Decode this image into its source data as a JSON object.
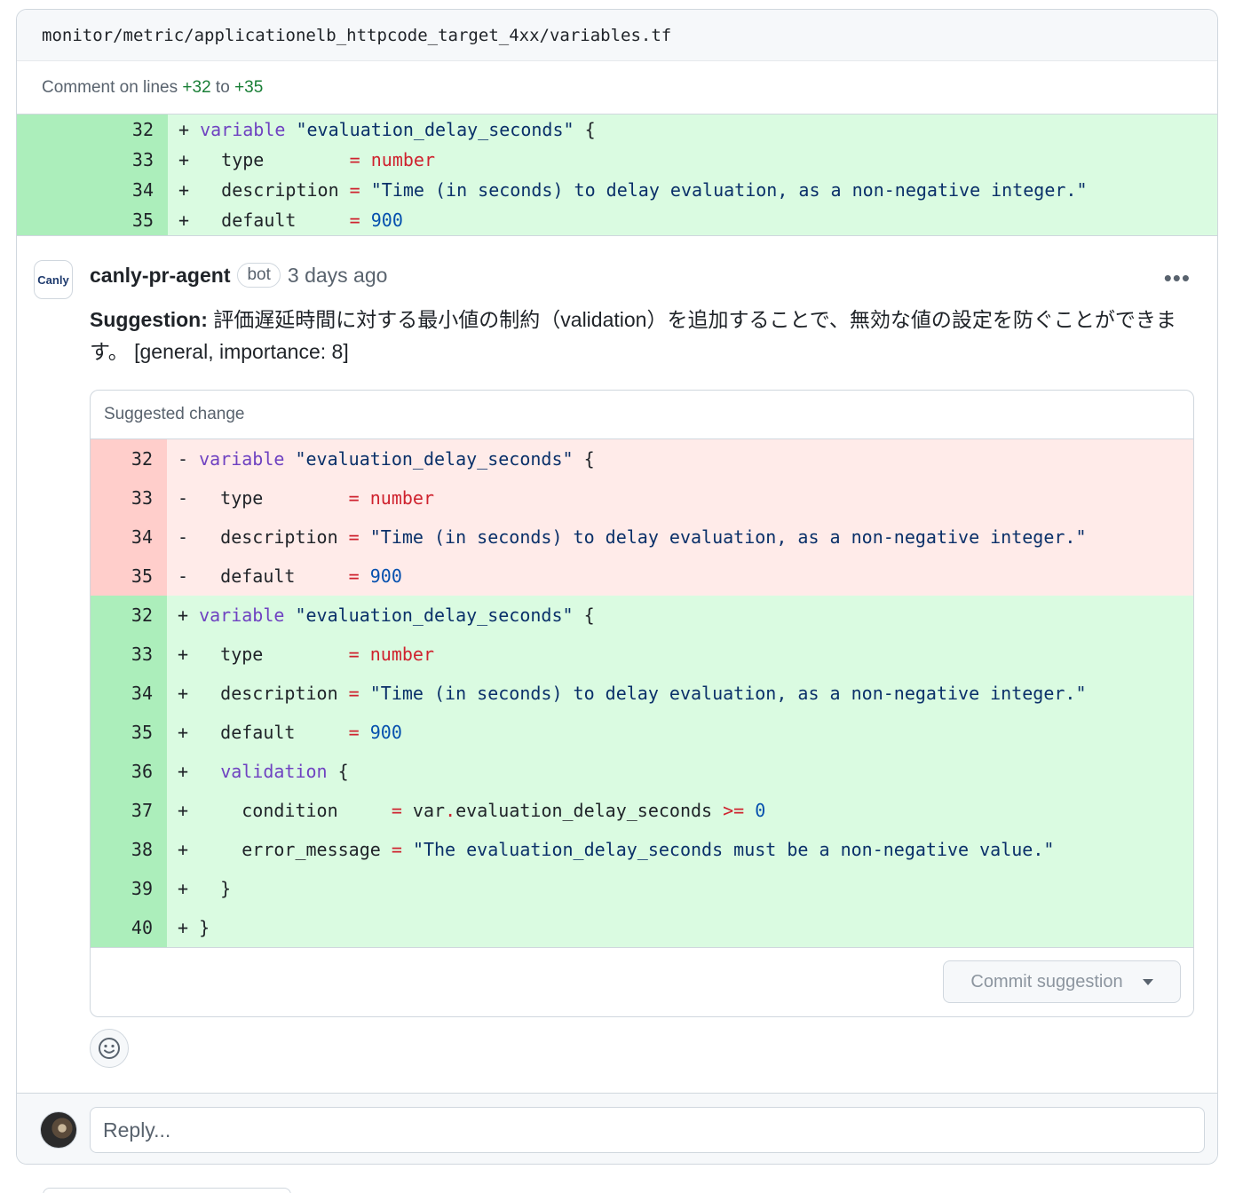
{
  "file": {
    "path": "monitor/metric/applicationelb_httpcode_target_4xx/variables.tf"
  },
  "comment_range": {
    "prefix": "Comment on lines",
    "start": "+32",
    "mid": "to",
    "end": "+35"
  },
  "top_diff": [
    {
      "ln": "32",
      "sign": "+",
      "parts": [
        [
          "kw",
          "variable"
        ],
        [
          "",
          " "
        ],
        [
          "str",
          "\"evaluation_delay_seconds\""
        ],
        [
          "",
          " {"
        ]
      ]
    },
    {
      "ln": "33",
      "sign": "+",
      "parts": [
        [
          "",
          "  type        "
        ],
        [
          "red",
          "= number"
        ]
      ]
    },
    {
      "ln": "34",
      "sign": "+",
      "parts": [
        [
          "",
          "  description "
        ],
        [
          "red",
          "="
        ],
        [
          "",
          " "
        ],
        [
          "str",
          "\"Time (in seconds) to delay evaluation, as a non-negative integer.\""
        ]
      ]
    },
    {
      "ln": "35",
      "sign": "+",
      "parts": [
        [
          "",
          "  default     "
        ],
        [
          "red",
          "="
        ],
        [
          "",
          " "
        ],
        [
          "blue",
          "900"
        ]
      ]
    }
  ],
  "comment": {
    "avatar_text": "Canly",
    "author": "canly-pr-agent",
    "badge": "bot",
    "time": "3 days ago",
    "menu": "•••",
    "suggestion_label": "Suggestion:",
    "suggestion_text": " 評価遅延時間に対する最小値の制約（validation）を追加することで、無効な値の設定を防ぐことができます。 [general, importance: 8]"
  },
  "suggested_change": {
    "title": "Suggested change",
    "deleted": [
      {
        "ln": "32",
        "sign": "-",
        "parts": [
          [
            "kw",
            "variable"
          ],
          [
            "",
            " "
          ],
          [
            "str",
            "\"evaluation_delay_seconds\""
          ],
          [
            "",
            " {"
          ]
        ]
      },
      {
        "ln": "33",
        "sign": "-",
        "parts": [
          [
            "",
            "  type        "
          ],
          [
            "red",
            "= number"
          ]
        ]
      },
      {
        "ln": "34",
        "sign": "-",
        "parts": [
          [
            "",
            "  description "
          ],
          [
            "red",
            "="
          ],
          [
            "",
            " "
          ],
          [
            "str",
            "\"Time (in seconds) to delay evaluation, as a non-negative integer.\""
          ]
        ]
      },
      {
        "ln": "35",
        "sign": "-",
        "parts": [
          [
            "",
            "  default     "
          ],
          [
            "red",
            "="
          ],
          [
            "",
            " "
          ],
          [
            "blue",
            "900"
          ]
        ]
      }
    ],
    "added": [
      {
        "ln": "32",
        "sign": "+",
        "parts": [
          [
            "kw",
            "variable"
          ],
          [
            "",
            " "
          ],
          [
            "str",
            "\"evaluation_delay_seconds\""
          ],
          [
            "",
            " {"
          ]
        ]
      },
      {
        "ln": "33",
        "sign": "+",
        "parts": [
          [
            "",
            "  type        "
          ],
          [
            "red",
            "= number"
          ]
        ]
      },
      {
        "ln": "34",
        "sign": "+",
        "parts": [
          [
            "",
            "  description "
          ],
          [
            "red",
            "="
          ],
          [
            "",
            " "
          ],
          [
            "str",
            "\"Time (in seconds) to delay evaluation, as a non-negative integer.\""
          ]
        ]
      },
      {
        "ln": "35",
        "sign": "+",
        "parts": [
          [
            "",
            "  default     "
          ],
          [
            "red",
            "="
          ],
          [
            "",
            " "
          ],
          [
            "blue",
            "900"
          ]
        ]
      },
      {
        "ln": "36",
        "sign": "+",
        "parts": [
          [
            "",
            "  "
          ],
          [
            "kw",
            "validation"
          ],
          [
            "",
            " {"
          ]
        ]
      },
      {
        "ln": "37",
        "sign": "+",
        "parts": [
          [
            "",
            "    condition     "
          ],
          [
            "red",
            "="
          ],
          [
            "",
            " var"
          ],
          [
            "red",
            "."
          ],
          [
            "",
            "evaluation_delay_seconds "
          ],
          [
            "red",
            ">="
          ],
          [
            "",
            " "
          ],
          [
            "blue",
            "0"
          ]
        ]
      },
      {
        "ln": "38",
        "sign": "+",
        "parts": [
          [
            "",
            "    error_message "
          ],
          [
            "red",
            "="
          ],
          [
            "",
            " "
          ],
          [
            "str",
            "\"The evaluation_delay_seconds must be a non-negative value.\""
          ]
        ]
      },
      {
        "ln": "39",
        "sign": "+",
        "parts": [
          [
            "",
            "  }"
          ]
        ]
      },
      {
        "ln": "40",
        "sign": "+",
        "parts": [
          [
            "",
            "}"
          ]
        ]
      }
    ],
    "commit_label": "Commit suggestion"
  },
  "reply": {
    "placeholder": "Reply..."
  },
  "icons": {
    "emoji": "smiley-icon",
    "caret": "triangle-down-icon",
    "menu": "kebab-icon"
  },
  "colors": {
    "add_bg": "#dafbe1",
    "add_ln": "#aceebb",
    "del_bg": "#ffebe9",
    "del_ln": "#ffcecb",
    "keyword": "#6f42c1",
    "string": "#0a3069",
    "operator": "#cf222e",
    "number": "#0550ae",
    "green_text": "#1a7f37"
  }
}
